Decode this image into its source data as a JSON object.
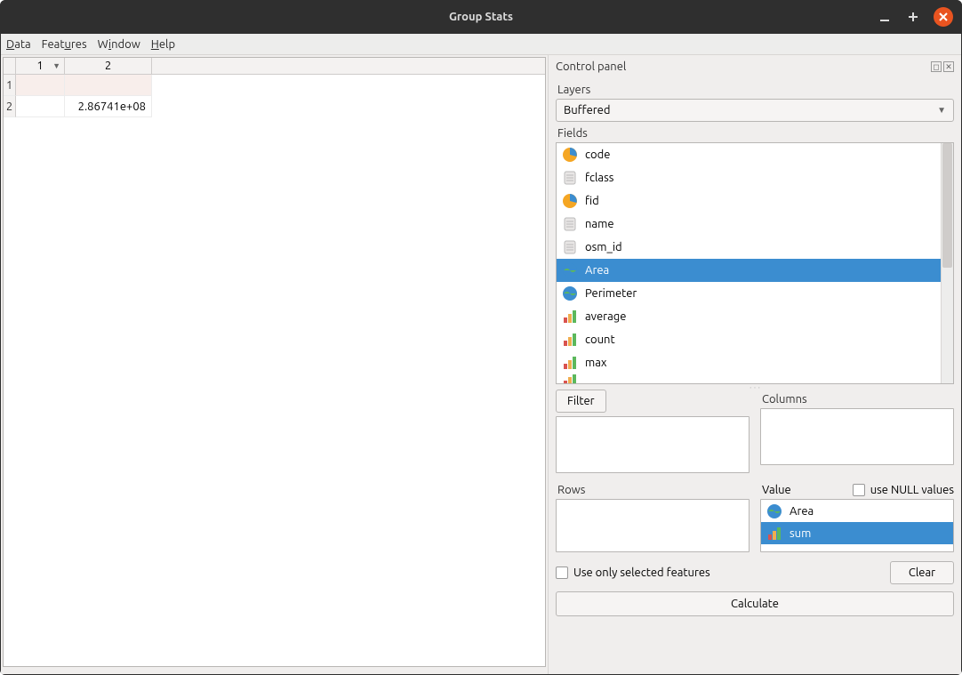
{
  "titlebar": {
    "title": "Group Stats"
  },
  "menubar": {
    "data": "Data",
    "features": "Features",
    "window": "Window",
    "help": "Help"
  },
  "sheet": {
    "col1": "1",
    "col2": "2",
    "row1": "1",
    "row2": "2",
    "r1c1": "",
    "r1c2": "",
    "r2c1": "",
    "r2c2": "2.86741e+08"
  },
  "panel": {
    "title": "Control panel",
    "layers_label": "Layers",
    "layers_value": "Buffered",
    "fields_label": "Fields",
    "fields": {
      "code": "code",
      "fclass": "fclass",
      "fid": "fid",
      "name": "name",
      "osm_id": "osm_id",
      "area": "Area",
      "perimeter": "Perimeter",
      "average": "average",
      "count": "count",
      "max": "max"
    },
    "filter_btn": "Filter",
    "columns_label": "Columns",
    "rows_label": "Rows",
    "value_label": "Value",
    "use_null": "use NULL values",
    "value_items": {
      "area": "Area",
      "sum": "sum"
    },
    "use_selected": "Use only selected features",
    "clear_btn": "Clear",
    "calculate_btn": "Calculate"
  }
}
